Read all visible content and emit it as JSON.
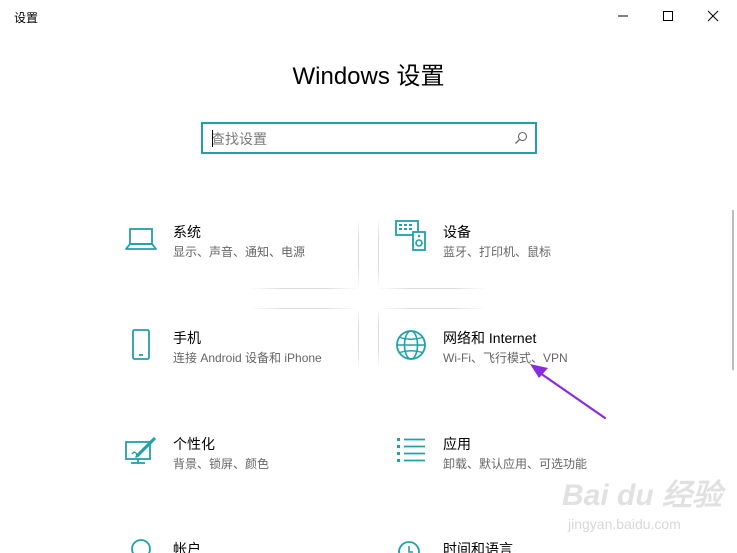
{
  "window": {
    "title": "设置"
  },
  "heading": "Windows 设置",
  "search": {
    "placeholder": "查找设置"
  },
  "tiles": [
    {
      "title": "系统",
      "desc": "显示、声音、通知、电源",
      "icon": "laptop-icon"
    },
    {
      "title": "设备",
      "desc": "蓝牙、打印机、鼠标",
      "icon": "keyboard-speaker-icon"
    },
    {
      "title": "手机",
      "desc": "连接 Android 设备和 iPhone",
      "icon": "phone-icon"
    },
    {
      "title": "网络和 Internet",
      "desc": "Wi-Fi、飞行模式、VPN",
      "icon": "globe-icon"
    },
    {
      "title": "个性化",
      "desc": "背景、锁屏、颜色",
      "icon": "paint-brush-icon"
    },
    {
      "title": "应用",
      "desc": "卸载、默认应用、可选功能",
      "icon": "app-list-icon"
    },
    {
      "title": "帐户",
      "desc": "",
      "icon": "person-icon"
    },
    {
      "title": "时间和语言",
      "desc": "",
      "icon": "clock-language-icon"
    }
  ],
  "watermark": {
    "brand": "Bai du 经验",
    "sub": "jingyan.baidu.com"
  },
  "colors": {
    "accent": "#1fa1a8",
    "annotation": "#8a2be2"
  }
}
